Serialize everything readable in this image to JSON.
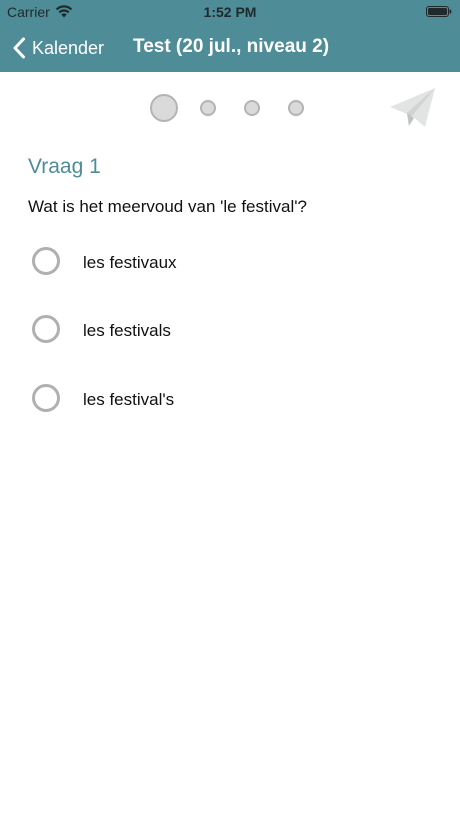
{
  "status_bar": {
    "carrier": "Carrier",
    "time": "1:52 PM"
  },
  "nav": {
    "back_label": "Kalender",
    "title": "Test (20 jul., niveau 2)"
  },
  "progress": {
    "current_step": 1,
    "total_steps": 4
  },
  "question": {
    "title": "Vraag 1",
    "text": "Wat is het meervoud van 'le festival'?",
    "options": [
      {
        "label": "les festivaux",
        "selected": false
      },
      {
        "label": "les festivals",
        "selected": false
      },
      {
        "label": "les festival's",
        "selected": false
      }
    ]
  },
  "colors": {
    "accent": "#4e8c98",
    "radio_border": "#b0b0b0",
    "step_fill": "#dadada"
  },
  "icons": {
    "wifi": "wifi-icon",
    "battery": "battery-icon",
    "back": "chevron-left-icon",
    "send": "paper-plane-icon"
  }
}
